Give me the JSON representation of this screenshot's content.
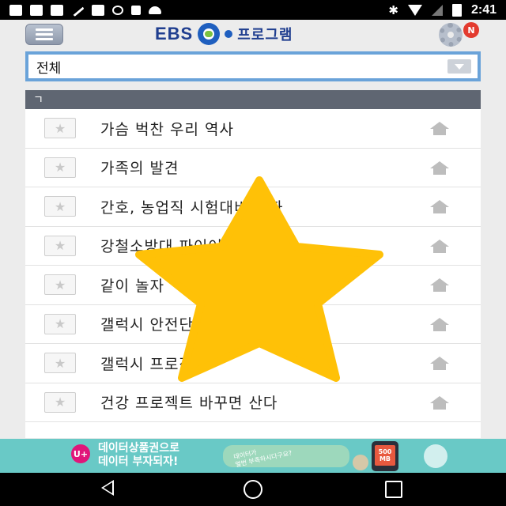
{
  "status_bar": {
    "time": "2:41",
    "left_icons": [
      "facebook-icon",
      "facebook-icon",
      "facebook-icon",
      "wrench-icon",
      "facebook-icon",
      "sync-icon",
      "lock-icon",
      "android-icon"
    ],
    "right_icons": [
      "bluetooth-icon",
      "wifi-icon",
      "no-signal-icon",
      "battery-icon"
    ]
  },
  "header": {
    "logo_text": "EBS",
    "title": "프로그램",
    "notification_badge": "N"
  },
  "filter": {
    "selected": "전체"
  },
  "list": {
    "section_label": "ㄱ",
    "items": [
      {
        "title": "가슴 벅찬 우리 역사"
      },
      {
        "title": "가족의 발견"
      },
      {
        "title": "간호, 농업직 시험대비 강좌"
      },
      {
        "title": "강철소방대 파이어로보"
      },
      {
        "title": "같이 놀자"
      },
      {
        "title": "갤럭시 안전단"
      },
      {
        "title": "갤럭시 프로젝트"
      },
      {
        "title": "건강 프로젝트 바꾸면 산다"
      }
    ]
  },
  "ad": {
    "line1": "데이터상품권으로",
    "line2": "데이터 부자되자!",
    "bubble_text1": "데이터가",
    "bubble_text2": "열번 부족하시다구요?",
    "phone_text": "500 MB",
    "badge": "U+"
  },
  "colors": {
    "accent": "#1f3e8f",
    "filter_border": "#6aa3d9",
    "section_bg": "#5f6672",
    "overlay_star": "#FFC107",
    "ad_bg": "#69c9c6"
  }
}
